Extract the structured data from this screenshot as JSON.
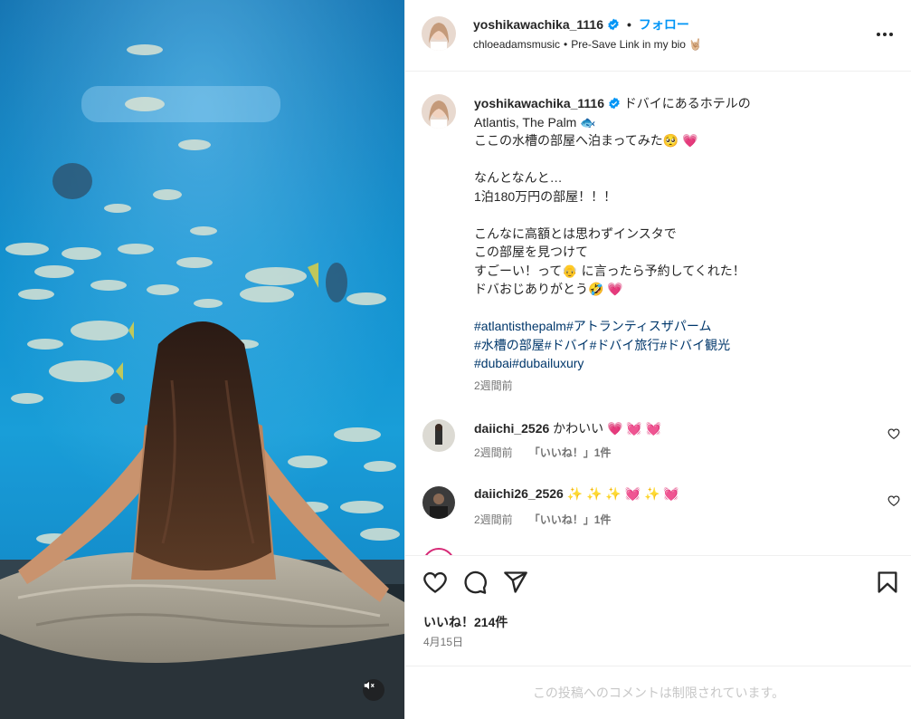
{
  "header": {
    "username": "yoshikawachika_1116",
    "follow_label": "フォロー",
    "separator": "•",
    "audio_artist": "chloeadamsmusic",
    "audio_separator": "•",
    "audio_title": "Pre-Save Link in my bio 🤘🏼"
  },
  "caption": {
    "username": "yoshikawachika_1116",
    "lines": [
      " ドバイにあるホテルの",
      "Atlantis, The Palm 🐟",
      "ここの水槽の部屋へ泊まってみた🥺 💗",
      "",
      "なんとなんと…",
      "1泊180万円の部屋！！！",
      "",
      "こんなに高額とは思わずインスタで",
      "この部屋を見つけて",
      "すごーい！って👴 に言ったら予約してくれた！",
      "ドバおじありがとう🤣 💗"
    ],
    "hashtags": [
      "#atlantisthepalm#アトランティスザパーム",
      "#水槽の部屋#ドバイ#ドバイ旅行#ドバイ観光",
      "#dubai#dubailuxury"
    ],
    "time": "2週間前"
  },
  "comments": [
    {
      "username": "daiichi_2526",
      "text": " かわいい 💗 💓 💓",
      "time": "2週間前",
      "likes": "「いいね！」1件"
    },
    {
      "username": "daiichi26_2526",
      "text": " ✨ ✨ ✨ 💓 ✨ 💓",
      "time": "2週間前",
      "likes": "「いいね！」1件"
    }
  ],
  "footer": {
    "likes": "いいね！214件",
    "date": "4月15日",
    "comments_restricted": "この投稿へのコメントは制限されています。"
  },
  "icons": {
    "verified": "verified-badge-icon",
    "more": "more-options-icon",
    "like": "heart-icon",
    "comment": "comment-icon",
    "share": "share-icon",
    "save": "bookmark-icon",
    "mute": "speaker-muted-icon"
  },
  "colors": {
    "accent": "#0095f6",
    "hashtag": "#00376b",
    "muted": "#737373",
    "verified": "#0095f6"
  }
}
